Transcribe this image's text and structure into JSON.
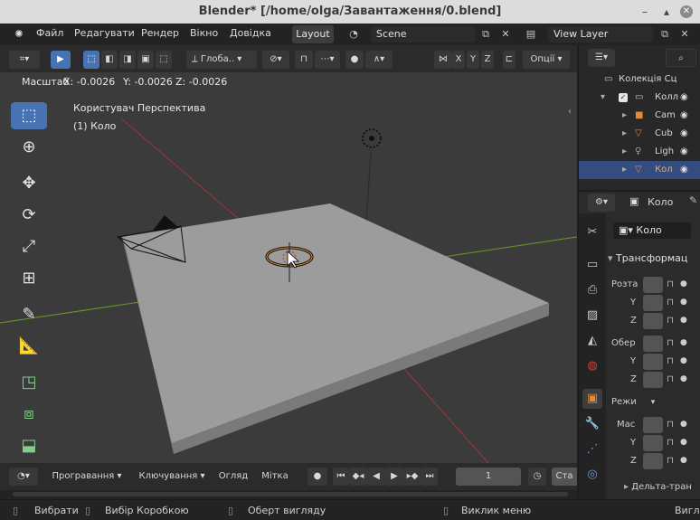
{
  "window": {
    "title": "Blender* [/home/olga/Завантаження/0.blend]"
  },
  "menu": [
    "Файл",
    "Редагувати",
    "Рендер",
    "Вікно",
    "Довідка"
  ],
  "workspace_tab": "Layout",
  "scene": {
    "name": "Scene"
  },
  "view_layer": {
    "name": "View Layer"
  },
  "viewport_header": {
    "orientation": "Глоба..",
    "axes": [
      "X",
      "Y",
      "Z"
    ],
    "options": "Опції"
  },
  "operator_readout": {
    "label": "Масштаб",
    "x": "X: -0.0026",
    "y": "Y: -0.0026",
    "z": "Z: -0.0026"
  },
  "viewport": {
    "view_name": "Користувач Перспектива",
    "active_object": "(1) Коло"
  },
  "outliner": {
    "collection": "Колекція Сц",
    "items": [
      {
        "label": "Колл",
        "icon": "collection-icon"
      },
      {
        "label": "Cam",
        "icon": "camera-icon"
      },
      {
        "label": "Cub",
        "icon": "mesh-icon"
      },
      {
        "label": "Ligh",
        "icon": "light-icon"
      },
      {
        "label": "Кол",
        "icon": "mesh-icon"
      }
    ]
  },
  "properties": {
    "object_name": "Коло",
    "panel_title": "Трансформац",
    "location_label": "Розта",
    "rotation_label": "Обер",
    "mode_label": "Режи",
    "scale_label": "Мас",
    "axis_y": "Y",
    "axis_z": "Z",
    "delta_label": "Дельта-тран"
  },
  "timeline": {
    "playback": "Програвання",
    "keying": "Ключування",
    "view": "Огляд",
    "marker": "Мітка",
    "current_frame": "1",
    "start_label": "Ста"
  },
  "statusbar": {
    "select": "Вибрати",
    "box_select": "Вибір Коробкою",
    "rotate_view": "Оберт вигляду",
    "context_menu": "Виклик меню",
    "right_text": "Вигл"
  },
  "colors": {
    "accent": "#4772b3",
    "selected_row": "#334d80",
    "object_orange": "#e08a3a",
    "x_axis": "#a0363e",
    "y_axis": "#6a9a2a"
  }
}
